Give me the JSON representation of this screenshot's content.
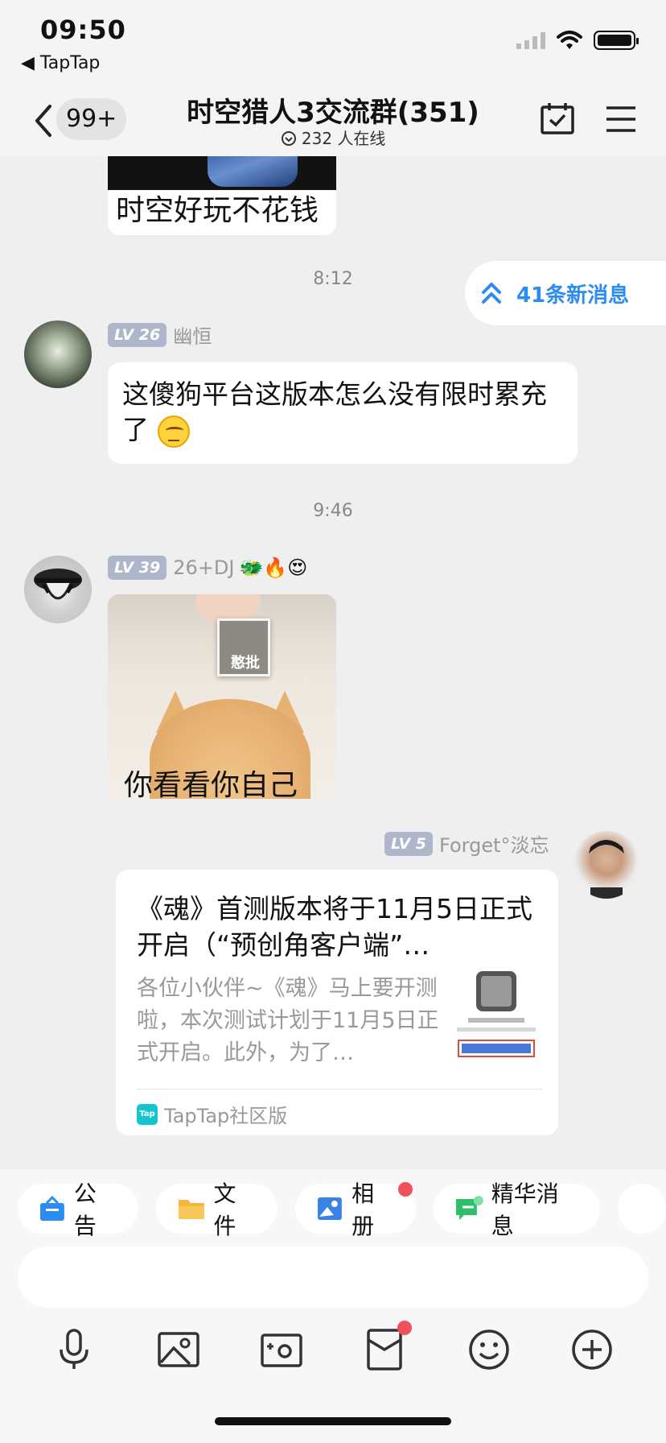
{
  "status_bar": {
    "time": "09:50",
    "back_app": "◀ TapTap"
  },
  "header": {
    "badge": "99+",
    "title": "时空猎人3交流群(351)",
    "online": "232 人在线"
  },
  "new_messages": "41条新消息",
  "messages": [
    {
      "type": "image",
      "caption": "时空好玩不花钱"
    },
    {
      "type": "time",
      "text": "8:12"
    },
    {
      "type": "text",
      "level": "LV 26",
      "name": "幽恒",
      "text": "这傻狗平台这版本怎么没有限时累充了"
    },
    {
      "type": "time",
      "text": "9:46"
    },
    {
      "type": "image",
      "level": "LV 39",
      "name": "26+DJ",
      "name_emojis": "🐲🔥😍",
      "card_text": "憨批",
      "caption": "你看看你自己"
    },
    {
      "type": "link",
      "level": "LV 5",
      "name": "Forget°淡忘",
      "title": "《魂》首测版本将于11月5日正式开启（“预创角客户端”…",
      "desc": "各位小伙伴~《魂》马上要开测啦，本次测试计划于11月5日正式开启。此外，为了…",
      "source": "TapTap社区版"
    }
  ],
  "chips": [
    {
      "label": "公告",
      "icon": "announcement-icon"
    },
    {
      "label": "文件",
      "icon": "folder-icon"
    },
    {
      "label": "相册",
      "icon": "album-icon",
      "dot": true
    },
    {
      "label": "精华消息",
      "icon": "featured-icon"
    }
  ],
  "toolbar": [
    "microphone-icon",
    "image-icon",
    "camera-icon",
    "red-packet-icon",
    "emoji-icon",
    "plus-icon"
  ],
  "colors": {
    "accent": "#2d8cf0",
    "level_badge": "#aeb6cc",
    "dot": "#f0505a",
    "tap": "#15c5ce"
  }
}
